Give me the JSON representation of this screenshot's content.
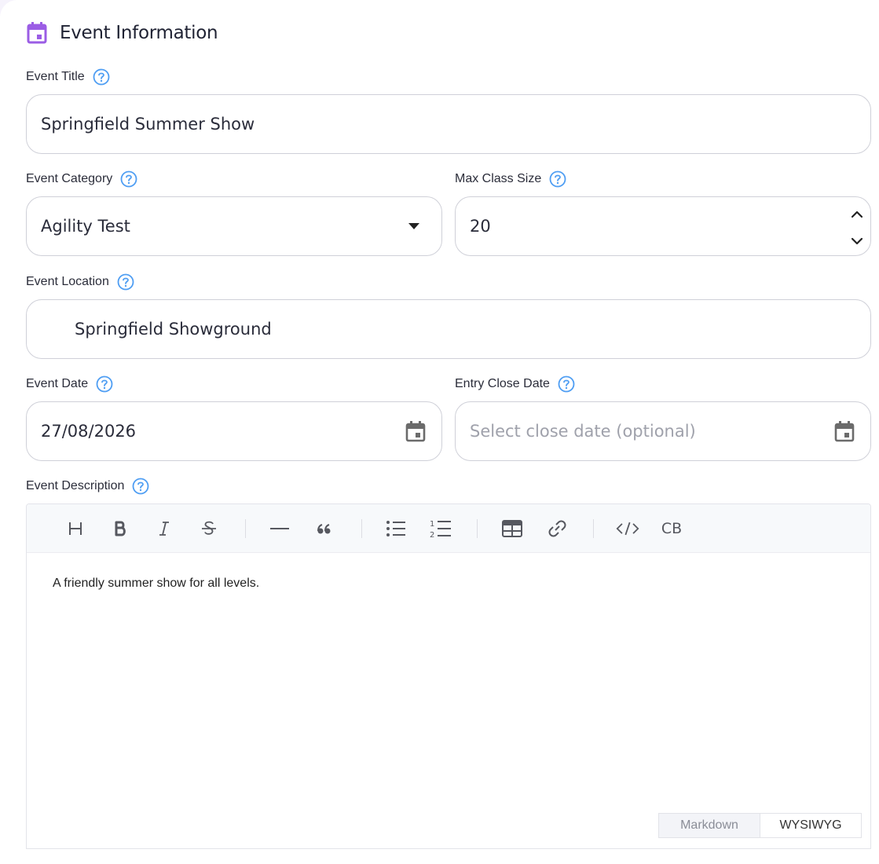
{
  "section": {
    "title": "Event Information",
    "icon": "calendar-icon",
    "accent": "#9b5de5"
  },
  "help_icon_color": "#4f9ef3",
  "fields": {
    "title": {
      "label": "Event Title",
      "value": "Springfield Summer Show"
    },
    "category": {
      "label": "Event Category",
      "value": "Agility Test"
    },
    "max_class_size": {
      "label": "Max Class Size",
      "value": "20"
    },
    "location": {
      "label": "Event Location",
      "value": "Springfield Showground"
    },
    "event_date": {
      "label": "Event Date",
      "value": "27/08/2026"
    },
    "entry_close_date": {
      "label": "Entry Close Date",
      "placeholder": "Select close date (optional)"
    },
    "description": {
      "label": "Event Description",
      "content": "A friendly summer show for all levels."
    }
  },
  "editor": {
    "toolbar": [
      "heading-icon",
      "bold-icon",
      "italic-icon",
      "strikethrough-icon",
      "horizontal-rule-icon",
      "quote-icon",
      "bullet-list-icon",
      "ordered-list-icon",
      "table-icon",
      "link-icon",
      "code-icon",
      "code-block-icon"
    ],
    "code_block_label": "CB",
    "modes": {
      "markdown": "Markdown",
      "wysiwyg": "WYSIWYG"
    }
  }
}
